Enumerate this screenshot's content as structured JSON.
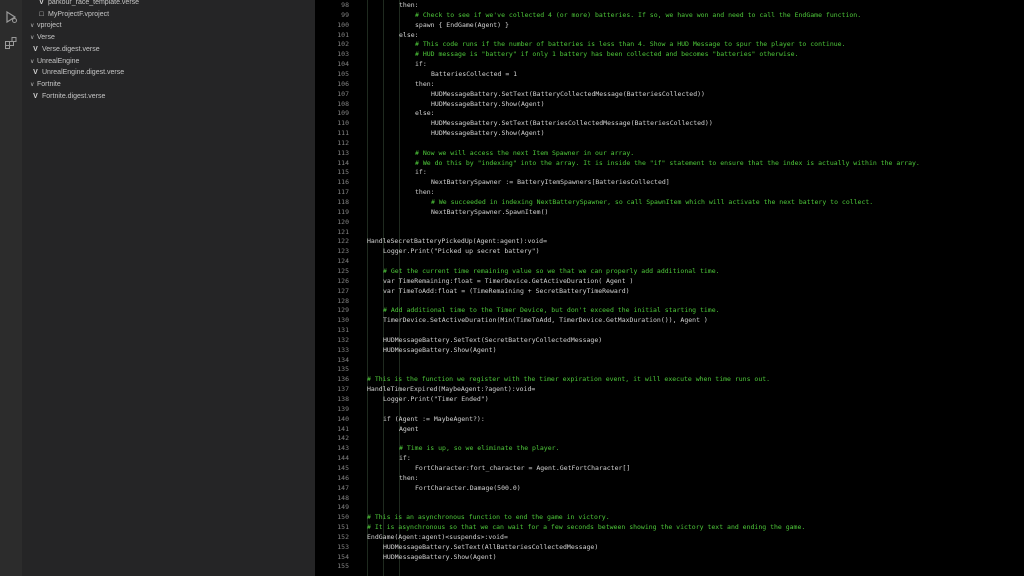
{
  "explorer": {
    "items": [
      {
        "label": "parkour_race_template.verse",
        "kind": "verse",
        "indent": 1
      },
      {
        "label": "MyProjectF.vproject",
        "kind": "file",
        "indent": 1
      },
      {
        "label": "vproject",
        "kind": "folder",
        "indent": 0
      },
      {
        "label": "Verse",
        "kind": "folder",
        "indent": 0
      },
      {
        "label": "Verse.digest.verse",
        "kind": "verse",
        "indent": 0
      },
      {
        "label": "UnrealEngine",
        "kind": "folder",
        "indent": 0
      },
      {
        "label": "UnrealEngine.digest.verse",
        "kind": "verse",
        "indent": 0
      },
      {
        "label": "Fortnite",
        "kind": "folder",
        "indent": 0
      },
      {
        "label": "Fortnite.digest.verse",
        "kind": "verse",
        "indent": 0
      }
    ]
  },
  "activity_bar": {
    "icons": [
      "run-debug-icon",
      "extensions-icon"
    ]
  },
  "editor": {
    "lines": [
      {
        "n": "98",
        "indent": 2,
        "type": "code",
        "text": "then:"
      },
      {
        "n": "99",
        "indent": 3,
        "type": "comment",
        "text": "# Check to see if we've collected 4 (or more) batteries. If so, we have won and need to call the EndGame function."
      },
      {
        "n": "100",
        "indent": 3,
        "type": "code",
        "text": "spawn { EndGame(Agent) }"
      },
      {
        "n": "101",
        "indent": 2,
        "type": "code",
        "text": "else:"
      },
      {
        "n": "102",
        "indent": 3,
        "type": "comment",
        "text": "# This code runs if the number of batteries is less than 4. Show a HUD Message to spur the player to continue."
      },
      {
        "n": "103",
        "indent": 3,
        "type": "comment",
        "text": "# HUD message is \"battery\" if only 1 battery has been collected and becomes \"batteries\" otherwise."
      },
      {
        "n": "104",
        "indent": 3,
        "type": "code",
        "text": "if:"
      },
      {
        "n": "105",
        "indent": 4,
        "type": "code",
        "text": "BatteriesCollected = 1"
      },
      {
        "n": "106",
        "indent": 3,
        "type": "code",
        "text": "then:"
      },
      {
        "n": "107",
        "indent": 4,
        "type": "code",
        "text": "HUDMessageBattery.SetText(BatteryCollectedMessage(BatteriesCollected))"
      },
      {
        "n": "108",
        "indent": 4,
        "type": "code",
        "text": "HUDMessageBattery.Show(Agent)"
      },
      {
        "n": "109",
        "indent": 3,
        "type": "code",
        "text": "else:"
      },
      {
        "n": "110",
        "indent": 4,
        "type": "code",
        "text": "HUDMessageBattery.SetText(BatteriesCollectedMessage(BatteriesCollected))"
      },
      {
        "n": "111",
        "indent": 4,
        "type": "code",
        "text": "HUDMessageBattery.Show(Agent)"
      },
      {
        "n": "112",
        "indent": 0,
        "type": "code",
        "text": ""
      },
      {
        "n": "113",
        "indent": 3,
        "type": "comment",
        "text": "# Now we will access the next Item Spawner in our array."
      },
      {
        "n": "114",
        "indent": 3,
        "type": "comment",
        "text": "# We do this by \"indexing\" into the array. It is inside the \"if\" statement to ensure that the index is actually within the array."
      },
      {
        "n": "115",
        "indent": 3,
        "type": "code",
        "text": "if:"
      },
      {
        "n": "116",
        "indent": 4,
        "type": "code",
        "text": "NextBatterySpawner := BatteryItemSpawners[BatteriesCollected]"
      },
      {
        "n": "117",
        "indent": 3,
        "type": "code",
        "text": "then:"
      },
      {
        "n": "118",
        "indent": 4,
        "type": "comment",
        "text": "# We succeeded in indexing NextBatterySpawner, so call SpawnItem which will activate the next battery to collect."
      },
      {
        "n": "119",
        "indent": 4,
        "type": "code",
        "text": "NextBatterySpawner.SpawnItem()"
      },
      {
        "n": "120",
        "indent": 0,
        "type": "code",
        "text": ""
      },
      {
        "n": "121",
        "indent": 0,
        "type": "code",
        "text": ""
      },
      {
        "n": "122",
        "indent": 0,
        "type": "code",
        "text": "HandleSecretBatteryPickedUp(Agent:agent):void="
      },
      {
        "n": "123",
        "indent": 1,
        "type": "code",
        "text": "Logger.Print(\"Picked up secret battery\")"
      },
      {
        "n": "124",
        "indent": 0,
        "type": "code",
        "text": ""
      },
      {
        "n": "125",
        "indent": 1,
        "type": "comment",
        "text": "# Get the current time remaining value so we that we can properly add additional time."
      },
      {
        "n": "126",
        "indent": 1,
        "type": "code",
        "text": "var TimeRemaining:float = TimerDevice.GetActiveDuration( Agent )"
      },
      {
        "n": "127",
        "indent": 1,
        "type": "code",
        "text": "var TimeToAdd:float = (TimeRemaining + SecretBatteryTimeReward)"
      },
      {
        "n": "128",
        "indent": 0,
        "type": "code",
        "text": ""
      },
      {
        "n": "129",
        "indent": 1,
        "type": "comment",
        "text": "# Add additional time to the Timer Device, but don't exceed the initial starting time."
      },
      {
        "n": "130",
        "indent": 1,
        "type": "code",
        "text": "TimerDevice.SetActiveDuration(Min(TimeToAdd, TimerDevice.GetMaxDuration()), Agent )"
      },
      {
        "n": "131",
        "indent": 0,
        "type": "code",
        "text": ""
      },
      {
        "n": "132",
        "indent": 1,
        "type": "code",
        "text": "HUDMessageBattery.SetText(SecretBatteryCollectedMessage)"
      },
      {
        "n": "133",
        "indent": 1,
        "type": "code",
        "text": "HUDMessageBattery.Show(Agent)"
      },
      {
        "n": "134",
        "indent": 0,
        "type": "code",
        "text": ""
      },
      {
        "n": "135",
        "indent": 0,
        "type": "code",
        "text": ""
      },
      {
        "n": "136",
        "indent": 0,
        "type": "comment",
        "text": "# This is the function we register with the timer expiration event, it will execute when time runs out."
      },
      {
        "n": "137",
        "indent": 0,
        "type": "code",
        "text": "HandleTimerExpired(MaybeAgent:?agent):void="
      },
      {
        "n": "138",
        "indent": 1,
        "type": "code",
        "text": "Logger.Print(\"Timer Ended\")"
      },
      {
        "n": "139",
        "indent": 0,
        "type": "code",
        "text": ""
      },
      {
        "n": "140",
        "indent": 1,
        "type": "code",
        "text": "if (Agent := MaybeAgent?):"
      },
      {
        "n": "141",
        "indent": 2,
        "type": "code",
        "text": "Agent"
      },
      {
        "n": "142",
        "indent": 0,
        "type": "code",
        "text": ""
      },
      {
        "n": "143",
        "indent": 2,
        "type": "comment",
        "text": "# Time is up, so we eliminate the player."
      },
      {
        "n": "144",
        "indent": 2,
        "type": "code",
        "text": "if:"
      },
      {
        "n": "145",
        "indent": 3,
        "type": "code",
        "text": "FortCharacter:fort_character = Agent.GetFortCharacter[]"
      },
      {
        "n": "146",
        "indent": 2,
        "type": "code",
        "text": "then:"
      },
      {
        "n": "147",
        "indent": 3,
        "type": "code",
        "text": "FortCharacter.Damage(500.0)"
      },
      {
        "n": "148",
        "indent": 0,
        "type": "code",
        "text": ""
      },
      {
        "n": "149",
        "indent": 0,
        "type": "code",
        "text": ""
      },
      {
        "n": "150",
        "indent": 0,
        "type": "comment",
        "text": "# This is an asynchronous function to end the game in victory."
      },
      {
        "n": "151",
        "indent": 0,
        "type": "comment",
        "text": "# It is asynchronous so that we can wait for a few seconds between showing the victory text and ending the game."
      },
      {
        "n": "152",
        "indent": 0,
        "type": "code",
        "text": "EndGame(Agent:agent)<suspends>:void="
      },
      {
        "n": "153",
        "indent": 1,
        "type": "code",
        "text": "HUDMessageBattery.SetText(AllBatteriesCollectedMessage)"
      },
      {
        "n": "154",
        "indent": 1,
        "type": "code",
        "text": "HUDMessageBattery.Show(Agent)"
      },
      {
        "n": "155",
        "indent": 0,
        "type": "code",
        "text": ""
      }
    ]
  },
  "colors": {
    "comment": "#4ec93a",
    "code": "#d4d4d4",
    "line_number": "#858585",
    "editor_bg": "#000000",
    "sidebar_bg": "#252526",
    "activity_bg": "#2c2c2c"
  }
}
